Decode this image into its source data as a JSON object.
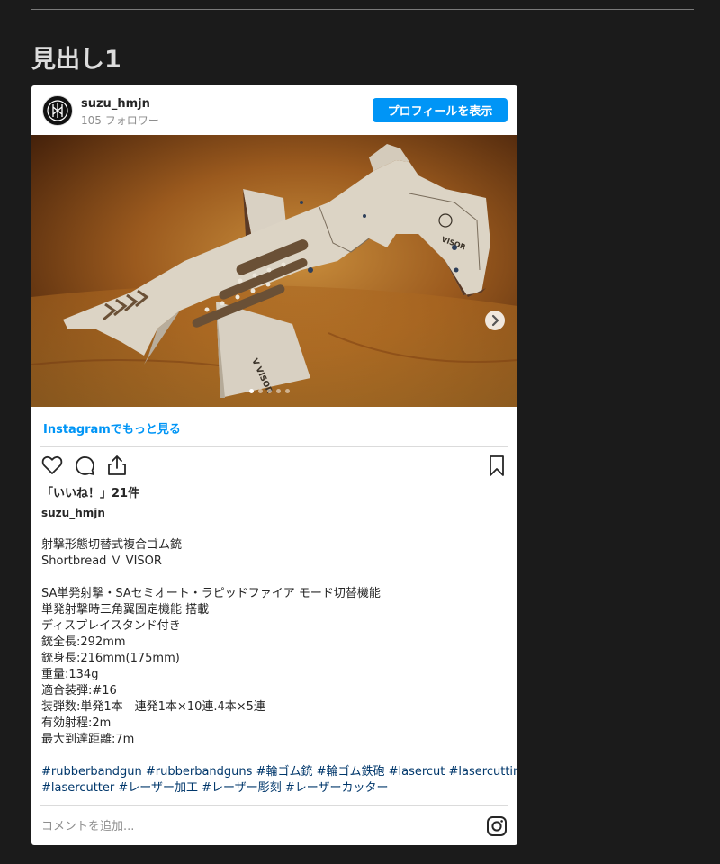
{
  "page": {
    "heading": "見出し1"
  },
  "post": {
    "username": "suzu_hmjn",
    "followers": "105 フォロワー",
    "profile_button": "プロフィールを表示",
    "more_link": "Instagramでもっと見る",
    "likes": "「いいね！」21件",
    "caption_user": "suzu_hmjn",
    "caption_lines": {
      "l1": "射撃形態切替式複合ゴム銃",
      "l2": "Shortbread Ｖ VISOR",
      "l3": "SA単発射撃・SAセミオート・ラピッドファイア モード切替機能",
      "l4": "単発射撃時三角翼固定機能 搭載",
      "l5": "ディスプレイスタンド付き",
      "l6": "銃全長:292mm",
      "l7": "銃身長:216mm(175mm)",
      "l8": "重量:134g",
      "l9": "適合装弾:#16",
      "l10": "装弾数:単発1本　連発1本×10連.4本×5連",
      "l11": "有効射程:2m",
      "l12": "最大到達距離:7m",
      "tags1": "#rubberbandgun #rubberbandguns #輪ゴム銃 #輪ゴム鉄砲 #lasercut #lasercutting",
      "tags2": "#lasercutter #レーザー加工 #レーザー彫刻 #レーザーカッター"
    },
    "comment_placeholder": "コメントを追加...",
    "carousel": {
      "slide_count": 5,
      "current": 1
    },
    "image_engraving": "VISOR",
    "stand_engraving": "V VISOR"
  },
  "icons": {
    "avatar": "logo-avatar",
    "next": "chevron-right-icon",
    "like": "heart-icon",
    "comment": "comment-icon",
    "share": "share-icon",
    "save": "bookmark-icon",
    "instagram": "instagram-icon"
  },
  "colors": {
    "background": "#1b1b1b",
    "accent": "#0095f6",
    "hashtag": "#00376b"
  }
}
